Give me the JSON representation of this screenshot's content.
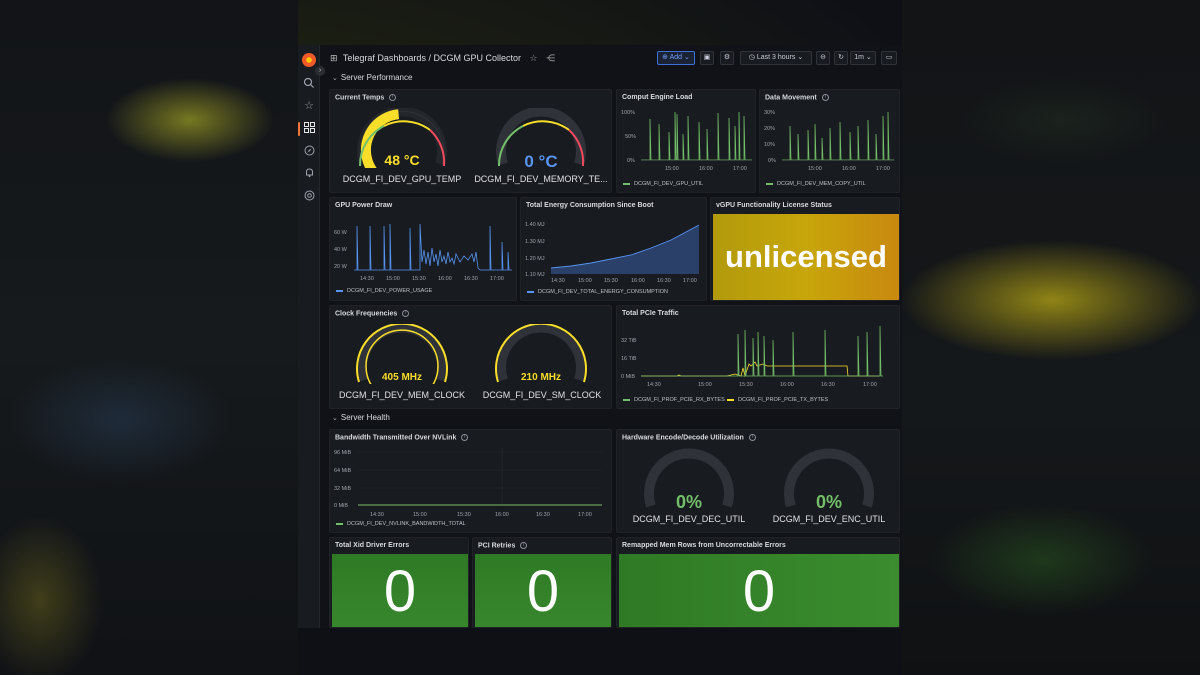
{
  "breadcrumb": {
    "parent": "Telegraf Dashboards",
    "separator": "/",
    "current": "DCGM GPU Collector"
  },
  "toolbar": {
    "add_label": "Add",
    "time_range": "Last 3 hours",
    "refresh_interval": "1m"
  },
  "rows": {
    "server_performance": "Server Performance",
    "server_health": "Server Health"
  },
  "colors": {
    "green": "#73bf69",
    "yellow": "#fade2a",
    "blue": "#5794f2",
    "orange": "#f3763b",
    "red": "#f2495c",
    "stat_green": "#37872d",
    "license_yellow": "#c79a0a"
  },
  "panels": {
    "current_temps": {
      "title": "Current Temps",
      "gauges": [
        {
          "value_text": "48 °C",
          "label": "DCGM_FI_DEV_GPU_TEMP",
          "fraction": 0.48
        },
        {
          "value_text": "0 °C",
          "label": "DCGM_FI_DEV_MEMORY_TE...",
          "fraction": 0.0
        }
      ]
    },
    "compute_engine_load": {
      "title": "Comput Engine Load",
      "y_ticks": [
        "100%",
        "50%",
        "0%"
      ],
      "x_ticks": [
        "15:00",
        "16:00",
        "17:00"
      ],
      "legend": "DCGM_FI_DEV_GPU_UTIL"
    },
    "data_movement": {
      "title": "Data Movement",
      "y_ticks": [
        "30%",
        "20%",
        "10%",
        "0%"
      ],
      "x_ticks": [
        "15:00",
        "16:00",
        "17:00"
      ],
      "legend": "DCGM_FI_DEV_MEM_COPY_UTIL"
    },
    "gpu_power_draw": {
      "title": "GPU Power Draw",
      "y_ticks": [
        "60 W",
        "40 W",
        "20 W"
      ],
      "x_ticks": [
        "14:30",
        "15:00",
        "15:30",
        "16:00",
        "16:30",
        "17:00"
      ],
      "legend": "DCGM_FI_DEV_POWER_USAGE"
    },
    "total_energy": {
      "title": "Total Energy Consumption Since Boot",
      "y_ticks": [
        "1.40 MJ",
        "1.30 MJ",
        "1.20 MJ",
        "1.10 MJ"
      ],
      "x_ticks": [
        "14:30",
        "15:00",
        "15:30",
        "16:00",
        "16:30",
        "17:00"
      ],
      "legend": "DCGM_FI_DEV_TOTAL_ENERGY_CONSUMPTION"
    },
    "vgpu_license": {
      "title": "vGPU Functionality License Status",
      "value": "unlicensed"
    },
    "clock_frequencies": {
      "title": "Clock Frequencies",
      "gauges": [
        {
          "value_text": "405 MHz",
          "label": "DCGM_FI_DEV_MEM_CLOCK",
          "fraction": 1.0
        },
        {
          "value_text": "210 MHz",
          "label": "DCGM_FI_DEV_SM_CLOCK",
          "fraction": 1.0
        }
      ]
    },
    "pcie_traffic": {
      "title": "Total PCIe Traffic",
      "y_ticks": [
        "32 TiB",
        "16 TiB",
        "0 MiB"
      ],
      "x_ticks": [
        "14:30",
        "15:00",
        "15:30",
        "16:00",
        "16:30",
        "17:00"
      ],
      "legend": [
        "DCGM_FI_PROF_PCIE_RX_BYTES",
        "DCGM_FI_PROF_PCIE_TX_BYTES"
      ]
    },
    "nvlink": {
      "title": "Bandwidth Transmitted Over NVLink",
      "y_ticks": [
        "96 MiB",
        "64 MiB",
        "32 MiB",
        "0 MiB"
      ],
      "x_ticks": [
        "14:30",
        "15:00",
        "15:30",
        "16:00",
        "16:30",
        "17:00"
      ],
      "legend": "DCGM_FI_DEV_NVLINK_BANDWIDTH_TOTAL"
    },
    "hw_encode_decode": {
      "title": "Hardware Encode/Decode Utilization",
      "gauges": [
        {
          "value_text": "0%",
          "label": "DCGM_FI_DEV_DEC_UTIL",
          "fraction": 0.0
        },
        {
          "value_text": "0%",
          "label": "DCGM_FI_DEV_ENC_UTIL",
          "fraction": 0.0
        }
      ]
    },
    "xid_errors": {
      "title": "Total Xid Driver Errors",
      "value": "0"
    },
    "pci_retries": {
      "title": "PCI Retries",
      "value": "0"
    },
    "remapped_rows": {
      "title": "Remapped Mem Rows from Uncorrectable Errors",
      "value": "0"
    }
  }
}
